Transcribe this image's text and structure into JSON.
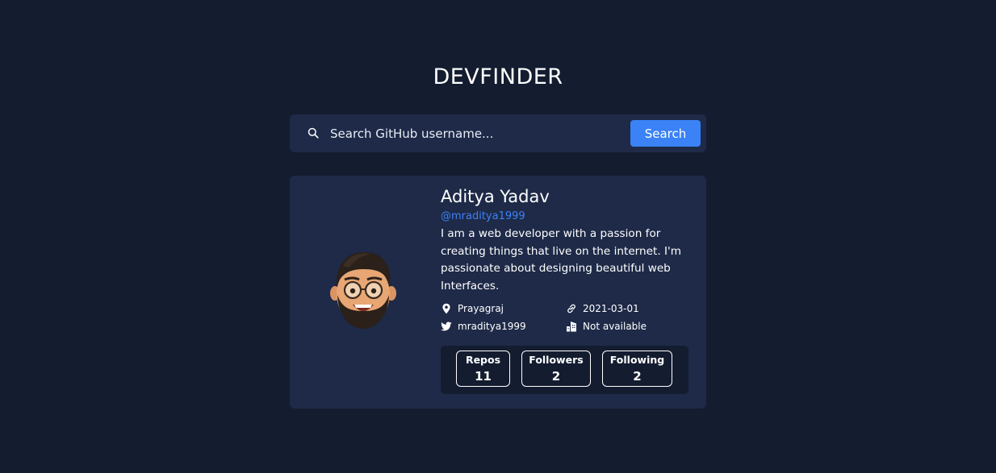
{
  "header": {
    "title": "DEVFINDER"
  },
  "search": {
    "placeholder": "Search GitHub username...",
    "value": "",
    "button_label": "Search",
    "icon": "search-icon"
  },
  "profile": {
    "name": "Aditya Yadav",
    "handle": "@mraditya1999",
    "bio": "I am a web developer with a passion for creating things that live on the internet. I'm passionate about designing beautiful web Interfaces.",
    "avatar_icon": "memoji-avatar",
    "meta": {
      "location": "Prayagraj",
      "blog": "2021-03-01",
      "twitter": "mraditya1999",
      "company": "Not available"
    },
    "stats": [
      {
        "label": "Repos",
        "value": "11"
      },
      {
        "label": "Followers",
        "value": "2"
      },
      {
        "label": "Following",
        "value": "2"
      }
    ]
  },
  "colors": {
    "background": "#141c30",
    "card": "#1e2a48",
    "accent": "#3b82f6",
    "text": "#ffffff"
  }
}
